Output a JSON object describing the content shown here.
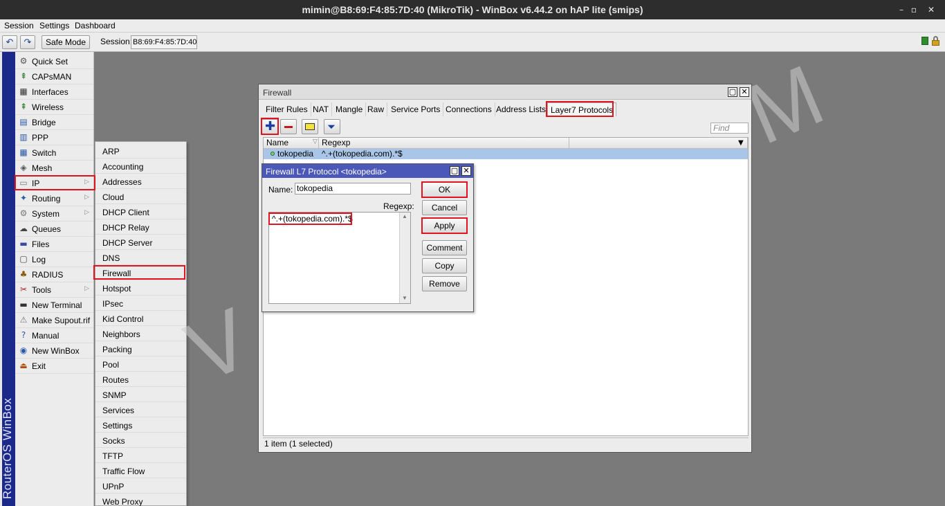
{
  "window": {
    "title": "mimin@B8:69:F4:85:7D:40 (MikroTik) - WinBox v6.44.2 on hAP lite (smips)",
    "controls": [
      "–",
      "▫",
      "✕"
    ]
  },
  "menubar": [
    "Session",
    "Settings",
    "Dashboard"
  ],
  "toolbar": {
    "safe_mode": "Safe Mode",
    "session_label": "Session:",
    "session_value": "B8:69:F4:85:7D:40"
  },
  "brand": "RouterOS WinBox",
  "sidebar": {
    "items": [
      {
        "label": "Quick Set",
        "icon": "quick-set-icon",
        "glyph": "⚙"
      },
      {
        "label": "CAPsMAN",
        "icon": "capsman-icon",
        "glyph": "⇞"
      },
      {
        "label": "Interfaces",
        "icon": "interfaces-icon",
        "glyph": "▦"
      },
      {
        "label": "Wireless",
        "icon": "wireless-icon",
        "glyph": "⇞"
      },
      {
        "label": "Bridge",
        "icon": "bridge-icon",
        "glyph": "▤"
      },
      {
        "label": "PPP",
        "icon": "ppp-icon",
        "glyph": "▥"
      },
      {
        "label": "Switch",
        "icon": "switch-icon",
        "glyph": "▦"
      },
      {
        "label": "Mesh",
        "icon": "mesh-icon",
        "glyph": "◈"
      },
      {
        "label": "IP",
        "icon": "ip-icon",
        "glyph": "▭",
        "submenu": true
      },
      {
        "label": "Routing",
        "icon": "routing-icon",
        "glyph": "✦",
        "submenu": true
      },
      {
        "label": "System",
        "icon": "system-icon",
        "glyph": "⚙",
        "submenu": true
      },
      {
        "label": "Queues",
        "icon": "queues-icon",
        "glyph": "☁"
      },
      {
        "label": "Files",
        "icon": "files-icon",
        "glyph": "▬"
      },
      {
        "label": "Log",
        "icon": "log-icon",
        "glyph": "▢"
      },
      {
        "label": "RADIUS",
        "icon": "radius-icon",
        "glyph": "♣"
      },
      {
        "label": "Tools",
        "icon": "tools-icon",
        "glyph": "✂",
        "submenu": true
      },
      {
        "label": "New Terminal",
        "icon": "terminal-icon",
        "glyph": "▬"
      },
      {
        "label": "Make Supout.rif",
        "icon": "supout-icon",
        "glyph": "⚠"
      },
      {
        "label": "Manual",
        "icon": "manual-icon",
        "glyph": "?"
      },
      {
        "label": "New WinBox",
        "icon": "winbox-icon",
        "glyph": "◉"
      },
      {
        "label": "Exit",
        "icon": "exit-icon",
        "glyph": "⏏"
      }
    ]
  },
  "ip_submenu": [
    "ARP",
    "Accounting",
    "Addresses",
    "Cloud",
    "DHCP Client",
    "DHCP Relay",
    "DHCP Server",
    "DNS",
    "Firewall",
    "Hotspot",
    "IPsec",
    "Kid Control",
    "Neighbors",
    "Packing",
    "Pool",
    "Routes",
    "SNMP",
    "Services",
    "Settings",
    "Socks",
    "TFTP",
    "Traffic Flow",
    "UPnP",
    "Web Proxy"
  ],
  "firewall": {
    "title": "Firewall",
    "tabs": [
      "Filter Rules",
      "NAT",
      "Mangle",
      "Raw",
      "Service Ports",
      "Connections",
      "Address Lists",
      "Layer7 Protocols"
    ],
    "active_tab": "Layer7 Protocols",
    "find_placeholder": "Find",
    "columns": [
      "Name",
      "Regexp"
    ],
    "rows": [
      {
        "name": "tokopedia",
        "regexp": "^.+(tokopedia.com).*$"
      }
    ],
    "status": "1 item (1 selected)"
  },
  "dialog": {
    "title": "Firewall L7 Protocol <tokopedia>",
    "name_label": "Name:",
    "name_value": "tokopedia",
    "regexp_label": "Regexp:",
    "regexp_value": "^.+(tokopedia.com).*$",
    "buttons": {
      "ok": "OK",
      "cancel": "Cancel",
      "apply": "Apply",
      "comment": "Comment",
      "copy": "Copy",
      "remove": "Remove"
    }
  },
  "watermark": "VASIOTA.COM",
  "colors": {
    "highlight": "#e0141e",
    "brand": "#1b2a8a",
    "selected_row": "#a9c6e8",
    "dialog_title": "#4b58b8"
  }
}
